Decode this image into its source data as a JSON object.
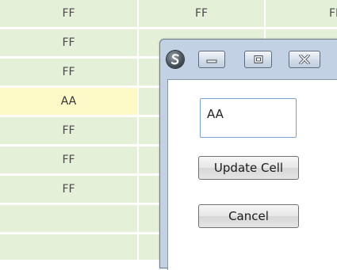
{
  "grid": {
    "rows": [
      [
        "FF",
        "FF",
        "FF"
      ],
      [
        "FF",
        "",
        ""
      ],
      [
        "FF",
        "",
        ""
      ],
      [
        "AA",
        "",
        ""
      ],
      [
        "FF",
        "",
        ""
      ],
      [
        "FF",
        "",
        ""
      ],
      [
        "FF",
        "",
        ""
      ]
    ],
    "highlighted_row": 3,
    "cell_color": "#e4f0d8",
    "highlight_color": "#fefac8"
  },
  "dialog": {
    "input_value": "AA",
    "update_label": "Update Cell",
    "cancel_label": "Cancel"
  },
  "icons": {
    "app": "app-logo-icon",
    "minimize": "minimize-icon",
    "maximize": "maximize-icon",
    "close": "close-icon"
  }
}
